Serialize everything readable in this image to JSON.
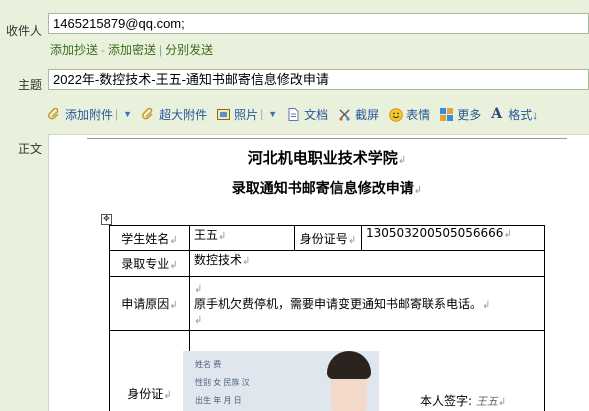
{
  "to": {
    "label": "收件人",
    "value": "1465215879@qq.com;"
  },
  "cc_links": {
    "add_cc": "添加抄送",
    "dash": "-",
    "add_bcc": "添加密送",
    "sep": "|",
    "separate": "分别发送"
  },
  "subject": {
    "label": "主题",
    "value": "2022年-数控技术-王五-通知书邮寄信息修改申请"
  },
  "toolbar": {
    "attach": "添加附件",
    "big_attach": "超大附件",
    "photo": "照片",
    "doc": "文档",
    "screenshot": "截屏",
    "emoji": "表情",
    "more": "更多",
    "format": "格式↓"
  },
  "body_label": "正文",
  "document": {
    "title": "河北机电职业技术学院",
    "subtitle": "录取通知书邮寄信息修改申请",
    "rows": {
      "name_label": "学生姓名",
      "name_value": "王五",
      "id_label": "身份证号",
      "id_value": "130503200505056666",
      "major_label": "录取专业",
      "major_value": "数控技术",
      "reason_label": "申请原因",
      "reason_value": "原手机欠费停机，需要申请变更通知书邮寄联系电话。",
      "idcard_label": "身份证"
    },
    "idcard": {
      "r1": "姓名 费",
      "r2": "性别 女  民族 汉",
      "r3": "出生       年   月  日"
    },
    "signature_label": "本人签字:",
    "signature_value": "王五"
  },
  "colors": {
    "bg": "#e9f1dd",
    "link": "#3a6b1a",
    "toolbar_text": "#2a5598"
  }
}
